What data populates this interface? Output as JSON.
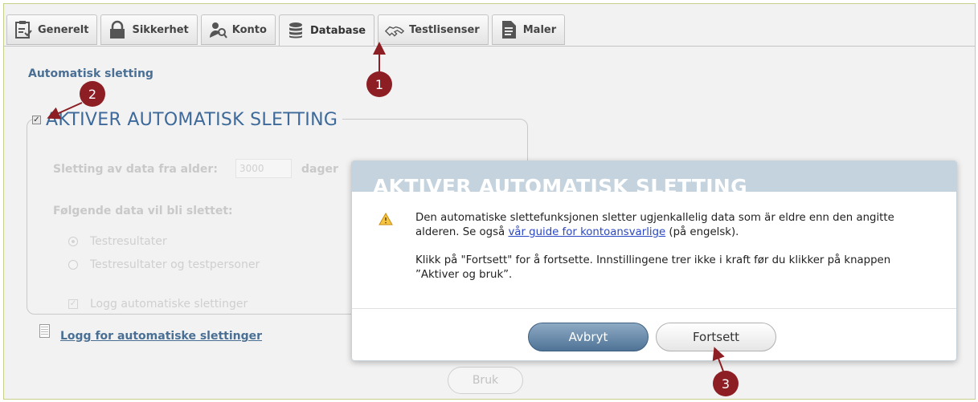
{
  "tabs": [
    {
      "label": "Generelt",
      "icon": "clipboard-icon"
    },
    {
      "label": "Sikkerhet",
      "icon": "lock-icon"
    },
    {
      "label": "Konto",
      "icon": "user-search-icon"
    },
    {
      "label": "Database",
      "icon": "database-icon",
      "active": true
    },
    {
      "label": "Testlisenser",
      "icon": "handshake-icon"
    },
    {
      "label": "Maler",
      "icon": "document-icon"
    }
  ],
  "section_title": "Automatisk sletting",
  "auto_delete": {
    "enable_label": "AKTIVER AUTOMATISK SLETTING",
    "enabled": true,
    "age_label": "Sletting av data fra alder:",
    "age_value": "3000",
    "age_unit": "dager",
    "data_label": "Følgende data vil bli slettet:",
    "options": [
      "Testresultater",
      "Testresultater og testpersoner"
    ],
    "log_label": "Logg automatiske slettinger"
  },
  "log_link": "Logg for automatiske slettinger",
  "apply_button": "Bruk",
  "dialog": {
    "title": "AKTIVER AUTOMATISK SLETTING",
    "line1": "Den automatiske slettefunksjonen sletter ugjenkallelig data som är eldre enn den angitte alderen. Se også ",
    "link": "vår guide for kontoansvarlige",
    "line1_end": " (på engelsk).",
    "line2": "Klikk på \"Fortsett\" for å fortsette. Innstillingene trer ikke i kraft før du klikker på knappen ”Aktiver og bruk”.",
    "cancel": "Avbryt",
    "continue": "Fortsett"
  },
  "markers": [
    "1",
    "2",
    "3"
  ],
  "colors": {
    "marker": "#8c1e24",
    "accent": "#4a6f95",
    "dialog_header": "#c5d3de"
  }
}
